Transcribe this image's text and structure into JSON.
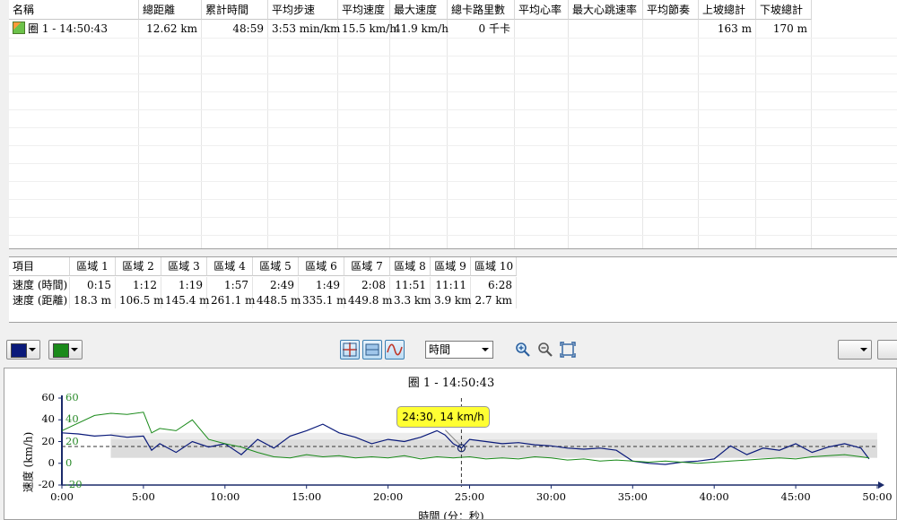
{
  "laps": {
    "columns": [
      "名稱",
      "總距離",
      "累計時間",
      "平均步速",
      "平均速度",
      "最大速度",
      "總卡路里數",
      "平均心率",
      "最大心跳速率",
      "平均節奏",
      "上坡總計",
      "下坡總計"
    ],
    "rows": [
      [
        "圈 1 - 14:50:43",
        "12.62 km",
        "48:59",
        "3:53 min/km",
        "15.5 km/h",
        "41.9 km/h",
        "0 千卡",
        "",
        "",
        "",
        "163 m",
        "170 m"
      ]
    ]
  },
  "zones": {
    "columns": [
      "項目",
      "區域 1",
      "區域 2",
      "區域 3",
      "區域 4",
      "區域 5",
      "區域 6",
      "區域 7",
      "區域 8",
      "區域 9",
      "區域 10"
    ],
    "rows": [
      [
        "速度 (時間)",
        "0:15",
        "1:12",
        "1:19",
        "1:57",
        "2:49",
        "1:49",
        "2:08",
        "11:51",
        "11:11",
        "6:28"
      ],
      [
        "速度 (距離)",
        "18.3 m",
        "106.5 m",
        "145.4 m",
        "261.1 m",
        "448.5 m",
        "335.1 m",
        "449.8 m",
        "3.3 km",
        "3.9 km",
        "2.7 km"
      ]
    ]
  },
  "toolbar": {
    "color1": "#0a1a7a",
    "color2": "#1a8a1a",
    "x_axis_select": "時間",
    "icons": [
      "crosshair-icon",
      "band-icon",
      "smooth-line-icon",
      "zoom-in-icon",
      "zoom-out-icon",
      "zoom-fit-icon"
    ]
  },
  "chart": {
    "title": "圈 1 - 14:50:43",
    "tooltip": "24:30, 14 km/h",
    "xlabel": "時間 (分：秒)",
    "ylabel": "速度 (km/h)",
    "x_ticks": [
      "0:00",
      "5:00",
      "10:00",
      "15:00",
      "20:00",
      "25:00",
      "30:00",
      "35:00",
      "40:00",
      "45:00",
      "50:00"
    ],
    "y_ticks": [
      "60",
      "40",
      "20",
      "0",
      "-20"
    ],
    "y2_ticks": [
      "60",
      "40",
      "20",
      "0",
      "-20"
    ]
  },
  "chart_data": {
    "type": "line",
    "title": "圈 1 - 14:50:43",
    "xlabel": "時間 (分：秒)",
    "ylabel": "速度 (km/h)",
    "xlim": [
      0,
      50
    ],
    "ylim": [
      -20,
      60
    ],
    "grid": false,
    "series": [
      {
        "color": "#0a1a7a",
        "x": [
          0,
          1,
          2,
          3,
          4,
          5,
          5.5,
          6,
          7,
          8,
          9,
          10,
          11,
          12,
          13,
          14,
          15,
          16,
          17,
          18,
          19,
          20,
          21,
          22,
          23,
          23.5,
          24,
          24.5,
          25,
          26,
          27,
          28,
          29,
          30,
          31,
          32,
          33,
          34,
          35,
          36,
          37,
          38,
          39,
          40,
          41,
          42,
          43,
          44,
          45,
          46,
          47,
          48,
          49,
          49.5
        ],
        "y": [
          28,
          27,
          25,
          26,
          24,
          25,
          12,
          18,
          10,
          20,
          15,
          18,
          8,
          22,
          14,
          25,
          30,
          36,
          28,
          24,
          18,
          22,
          20,
          24,
          30,
          26,
          18,
          14,
          22,
          20,
          18,
          19,
          17,
          16,
          14,
          13,
          14,
          12,
          2,
          0,
          -1,
          1,
          2,
          4,
          16,
          8,
          14,
          12,
          18,
          10,
          15,
          18,
          14,
          4
        ]
      },
      {
        "color": "#1a8a1a",
        "x": [
          0,
          2,
          3,
          4,
          5,
          5.5,
          6,
          7,
          8,
          9,
          10,
          11,
          12,
          13,
          14,
          15,
          16,
          17,
          18,
          19,
          20,
          21,
          22,
          23,
          24,
          25,
          26,
          27,
          28,
          29,
          30,
          31,
          32,
          33,
          34,
          35,
          36,
          37,
          38,
          39,
          40,
          41,
          42,
          43,
          44,
          45,
          46,
          47,
          48,
          49,
          49.5
        ],
        "y": [
          30,
          44,
          46,
          45,
          47,
          28,
          32,
          30,
          40,
          22,
          18,
          15,
          10,
          6,
          5,
          8,
          6,
          7,
          5,
          6,
          5,
          7,
          4,
          6,
          5,
          6,
          4,
          5,
          4,
          6,
          5,
          3,
          4,
          2,
          3,
          2,
          1,
          2,
          1,
          0,
          1,
          2,
          3,
          4,
          5,
          4,
          6,
          7,
          8,
          6,
          5
        ]
      }
    ],
    "annotations": [
      {
        "x": 24.5,
        "y": 14,
        "text": "24:30, 14 km/h"
      }
    ]
  }
}
